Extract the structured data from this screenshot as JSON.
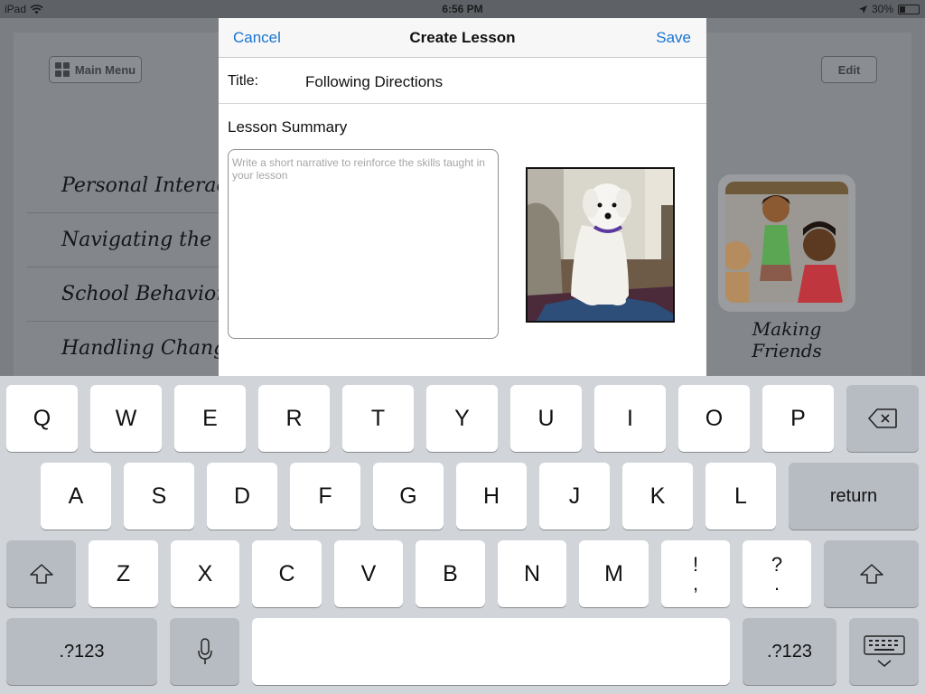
{
  "status_bar": {
    "device": "iPad",
    "time": "6:56 PM",
    "battery": "30%",
    "battery_level": 0.3
  },
  "background": {
    "main_menu_label": "Main Menu",
    "edit_label": "Edit",
    "lessons": [
      "Personal Interactions",
      "Navigating the Community",
      "School Behavior",
      "Handling Change"
    ],
    "card_label": "Making Friends"
  },
  "modal": {
    "cancel_label": "Cancel",
    "title": "Create Lesson",
    "save_label": "Save",
    "title_label": "Title:",
    "title_value": "Following Directions",
    "summary_label": "Lesson Summary",
    "summary_placeholder": "Write a short narrative to reinforce the skills taught in your lesson",
    "summary_value": ""
  },
  "keyboard": {
    "row1": [
      "Q",
      "W",
      "E",
      "R",
      "T",
      "Y",
      "U",
      "I",
      "O",
      "P"
    ],
    "row2": [
      "A",
      "S",
      "D",
      "F",
      "G",
      "H",
      "J",
      "K",
      "L"
    ],
    "row3": [
      "Z",
      "X",
      "C",
      "V",
      "B",
      "N",
      "M"
    ],
    "excl_top": "!",
    "excl_bottom": ",",
    "quest_top": "?",
    "quest_bottom": ".",
    "return_label": "return",
    "numbers_label": ".?123",
    "shift_icon": "shift-icon",
    "delete_icon": "delete-icon",
    "mic_icon": "microphone-icon",
    "hide_icon": "keyboard-dismiss-icon"
  },
  "colors": {
    "accent": "#1a74d1",
    "keyboard_bg": "#d1d4d9",
    "key_dark": "#b7bcc3"
  }
}
